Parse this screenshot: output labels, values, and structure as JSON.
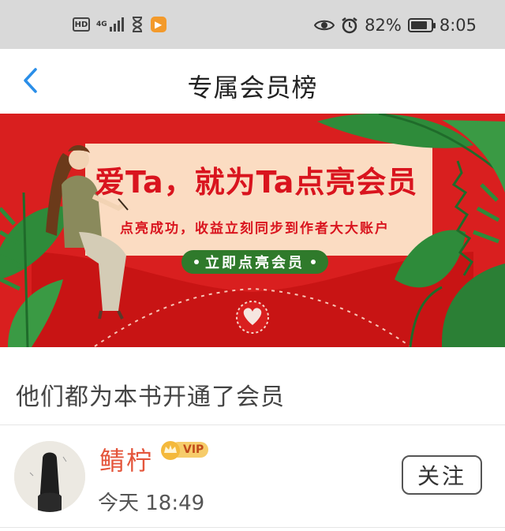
{
  "status_bar": {
    "hd_label": "HD",
    "network_label": "4G",
    "battery_percent": "82%",
    "battery_level": 0.82,
    "time": "8:05",
    "icons": [
      "hd-icon",
      "signal-icon",
      "hourglass-icon",
      "app-play-icon",
      "eye-icon",
      "alarm-icon",
      "battery-icon"
    ]
  },
  "nav": {
    "title": "专属会员榜",
    "back_icon": "chevron-left-icon"
  },
  "banner": {
    "headline": "爱Ta，就为Ta点亮会员",
    "subtitle": "点亮成功，收益立刻同步到作者大大账户",
    "button_label": "立即点亮会员",
    "colors": {
      "background": "#d91f1f",
      "card": "#fbdcc2",
      "button": "#2f7a2b",
      "leaf": "#2e8b3a"
    }
  },
  "section": {
    "heading": "他们都为本书开通了会员"
  },
  "members": [
    {
      "name": "鲭柠",
      "vip_label": "VIP",
      "time": "今天 18:49",
      "follow_label": "关注"
    }
  ],
  "colors": {
    "accent_blue": "#2a8ee8",
    "name_orange": "#e4553b",
    "vip_gold": "#f6cc6a"
  }
}
